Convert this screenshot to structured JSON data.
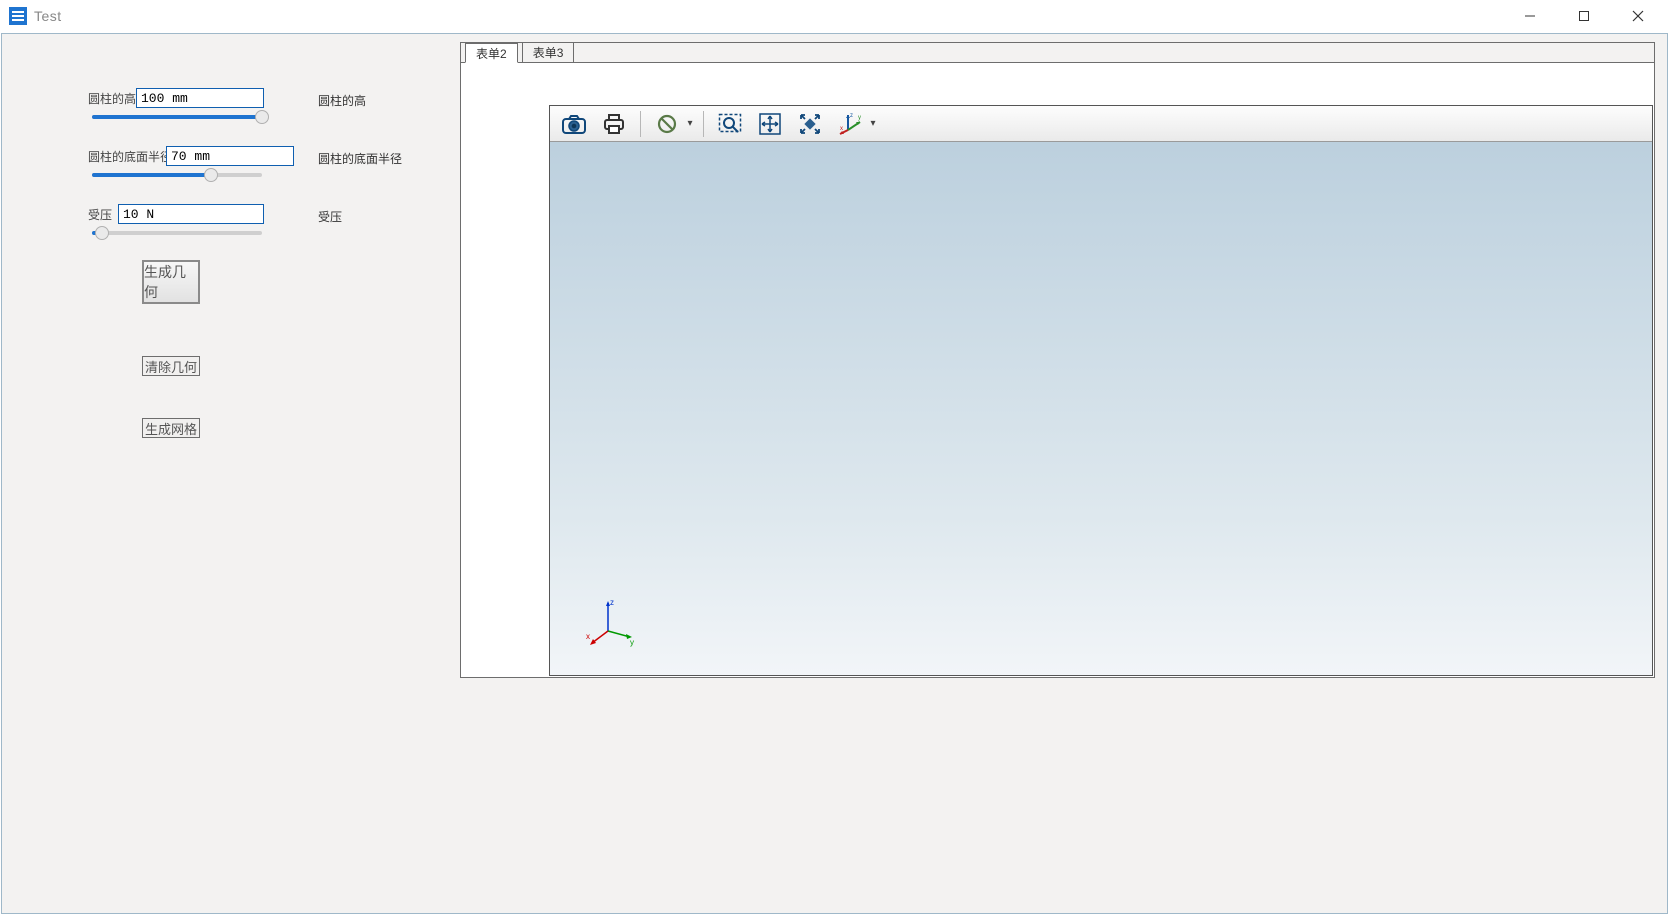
{
  "window": {
    "title": "Test"
  },
  "left": {
    "param1": {
      "label": "圆柱的高",
      "value": "100 mm",
      "rlabel": "圆柱的高",
      "slider_pct": 100
    },
    "param2": {
      "label": "圆柱的底面半径",
      "value": "70 mm",
      "rlabel": "圆柱的底面半径",
      "slider_pct": 70
    },
    "param3": {
      "label": "受压",
      "value": "10 N",
      "rlabel": "受压",
      "slider_pct": 6
    },
    "btn_generate_geom": "生成几何",
    "btn_clear_geom": "清除几何",
    "btn_generate_mesh": "生成网格"
  },
  "tabs": {
    "tab2": "表单2",
    "tab3": "表单3",
    "active": "表单2"
  },
  "toolbar_icons": {
    "camera": "camera-icon",
    "print": "print-icon",
    "forbid": "forbid-icon",
    "zoom_select": "zoom-select-icon",
    "pan": "pan-icon",
    "fit": "fit-icon",
    "axes": "axes-icon"
  },
  "axis_labels": {
    "x": "x",
    "y": "y",
    "z": "z"
  }
}
